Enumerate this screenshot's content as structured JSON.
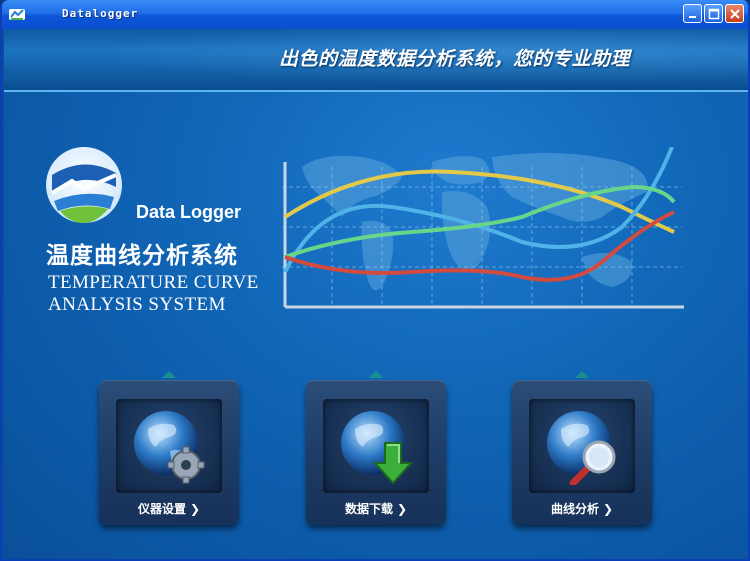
{
  "window": {
    "title": "Datalogger"
  },
  "header": {
    "slogan": "出色的温度数据分析系统，您的专业助理"
  },
  "branding": {
    "logo_text": "Data Logger",
    "title_cn": "温度曲线分析系统",
    "title_en_line1": "TEMPERATURE CURVE",
    "title_en_line2": "ANALYSIS SYSTEM"
  },
  "tiles": [
    {
      "label": "仪器设置",
      "icon": "globe-gear-icon"
    },
    {
      "label": "数据下载",
      "icon": "globe-download-icon"
    },
    {
      "label": "曲线分析",
      "icon": "globe-magnifier-icon"
    }
  ],
  "colors": {
    "titlebar": "#0c55d6",
    "background": "#1268b9",
    "tile": "#1c3a63",
    "curve_yellow": "#e3c94a",
    "curve_blue": "#4fb3e8",
    "curve_green": "#68d68a",
    "curve_red": "#d34a3f"
  }
}
